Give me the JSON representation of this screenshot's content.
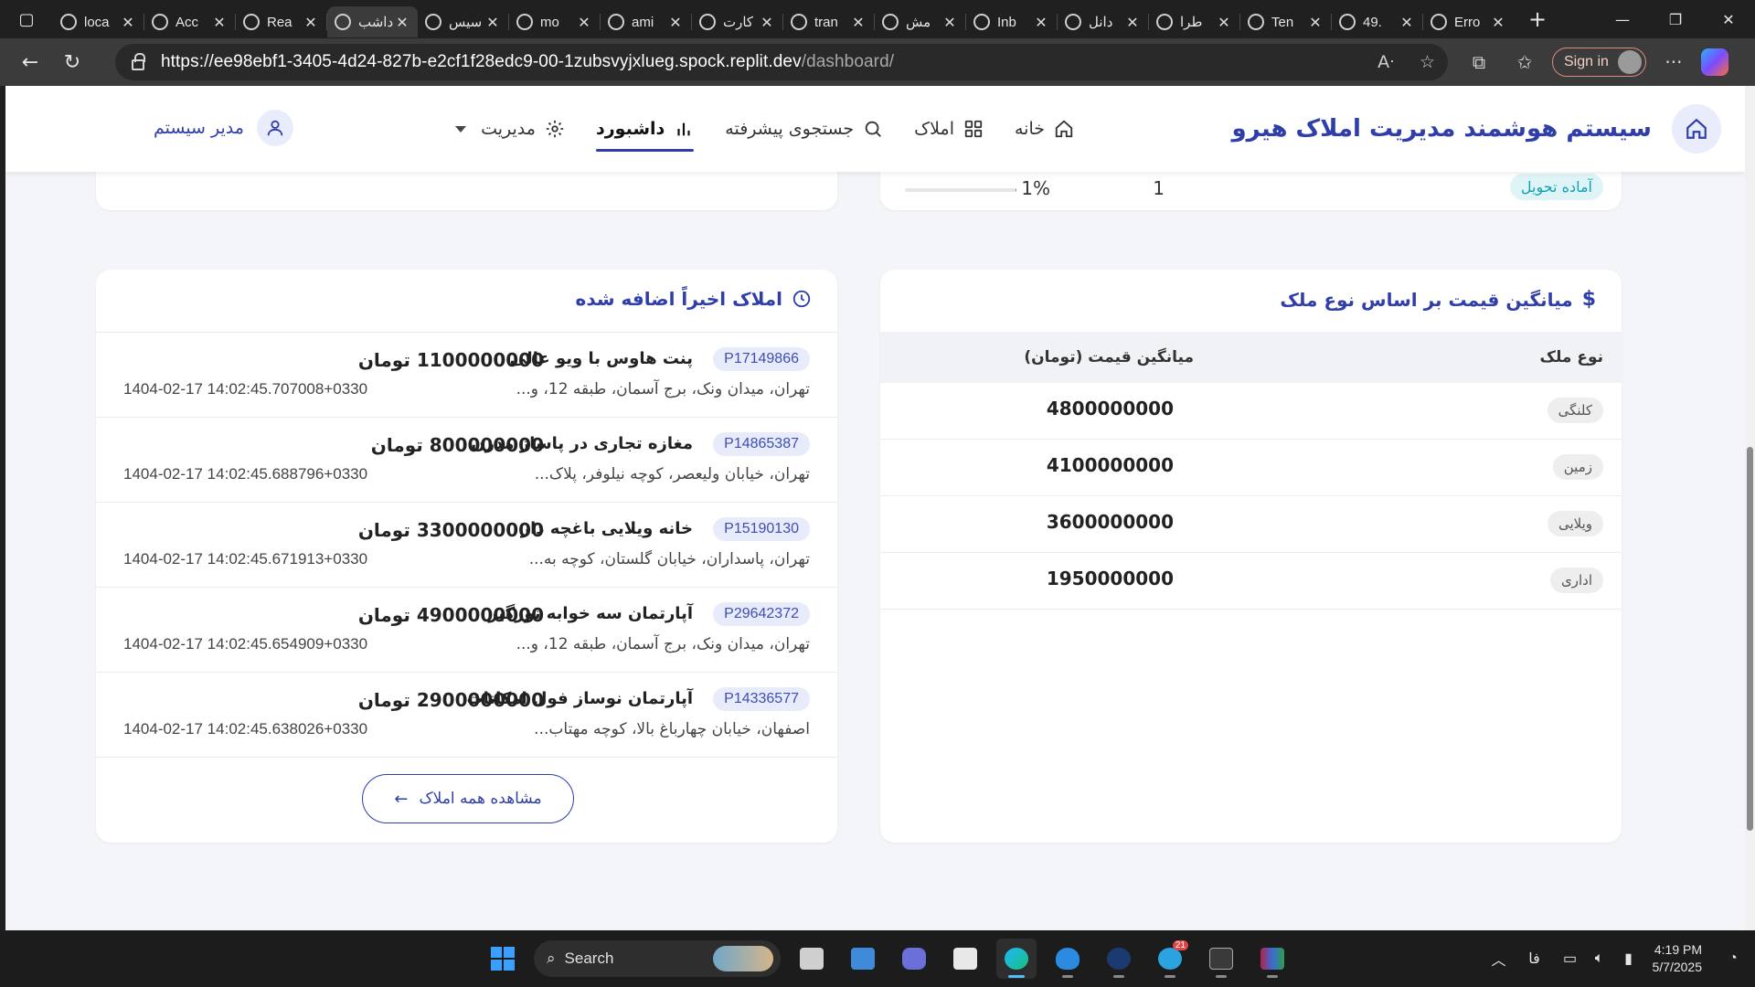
{
  "browser": {
    "tabs": [
      {
        "title": "loca",
        "active": false
      },
      {
        "title": "Acc",
        "active": false
      },
      {
        "title": "Rea",
        "active": false
      },
      {
        "title": "داشب",
        "active": true
      },
      {
        "title": "سیس",
        "active": false
      },
      {
        "title": "mo",
        "active": false
      },
      {
        "title": "ami",
        "active": false
      },
      {
        "title": "کارت",
        "active": false
      },
      {
        "title": "tran",
        "active": false
      },
      {
        "title": "مش",
        "active": false
      },
      {
        "title": "Inb",
        "active": false
      },
      {
        "title": "دانل",
        "active": false
      },
      {
        "title": "طرا",
        "active": false
      },
      {
        "title": "Ten",
        "active": false
      },
      {
        "title": "49.",
        "active": false
      },
      {
        "title": "Erro",
        "active": false
      }
    ],
    "url_host": "https://ee98ebf1-3405-4d24-827b-e2cf1f28edc9-00-1zubsvyjxlueg.spock.replit.dev",
    "url_path": "/dashboard/",
    "signin_label": "Sign in"
  },
  "app": {
    "title": "سیستم هوشمند مدیریت املاک هیرو",
    "nav": [
      {
        "label": "خانه",
        "icon": "home-icon",
        "active": false
      },
      {
        "label": "املاک",
        "icon": "grid-icon",
        "active": false
      },
      {
        "label": "جستجوی پیشرفته",
        "icon": "search-icon",
        "active": false
      },
      {
        "label": "داشبورد",
        "icon": "bar-chart-icon",
        "active": true
      },
      {
        "label": "مدیریت",
        "icon": "gear-icon",
        "active": false
      }
    ],
    "user_label": "مدیر سیستم"
  },
  "status_row": {
    "status_label": "آماده تحویل",
    "count": "1",
    "percent_label": "1%",
    "percent_value": 1
  },
  "price_card": {
    "title": "میانگین قیمت بر اساس نوع ملک",
    "col_type": "نوع ملک",
    "col_price": "میانگین قیمت (تومان)",
    "rows": [
      {
        "type": "کلنگی",
        "price": "4800000000"
      },
      {
        "type": "زمین",
        "price": "4100000000"
      },
      {
        "type": "ویلایی",
        "price": "3600000000"
      },
      {
        "type": "اداری",
        "price": "1950000000"
      }
    ]
  },
  "recent_card": {
    "title": "املاک اخیراً اضافه شده",
    "currency": "تومان",
    "items": [
      {
        "code": "P17149866",
        "title": "پنت هاوس با ویو عالی",
        "address": "تهران، میدان ونک، برج آسمان، طبقه 12، و...",
        "price": "1100000000",
        "date": "1404-02-17 14:02:45.707008+0330"
      },
      {
        "code": "P14865387",
        "title": "مغازه تجاری در پاساژ مدرن",
        "address": "تهران، خیابان ولیعصر، کوچه نیلوفر، پلاک...",
        "price": "800000000",
        "date": "1404-02-17 14:02:45.688796+0330"
      },
      {
        "code": "P15190130",
        "title": "خانه ویلایی باغچه دار",
        "address": "تهران، پاسداران، خیابان گلستان، کوچه به...",
        "price": "3300000000",
        "date": "1404-02-17 14:02:45.671913+0330"
      },
      {
        "code": "P29642372",
        "title": "آپارتمان سه خوابه نورگیر",
        "address": "تهران، میدان ونک، برج آسمان، طبقه 12، و...",
        "price": "4900000000",
        "date": "1404-02-17 14:02:45.654909+0330"
      },
      {
        "code": "P14336577",
        "title": "آپارتمان نوساز فول امکانات",
        "address": "اصفهان، خیابان چهارباغ بالا، کوچه مهتاب...",
        "price": "2900000000",
        "date": "1404-02-17 14:02:45.638026+0330"
      }
    ],
    "view_all_label": "مشاهده همه املاک"
  },
  "taskbar": {
    "search_label": "Search",
    "lang": "فا",
    "time": "4:19 PM",
    "date": "5/7/2025",
    "telegram_badge": "21"
  }
}
